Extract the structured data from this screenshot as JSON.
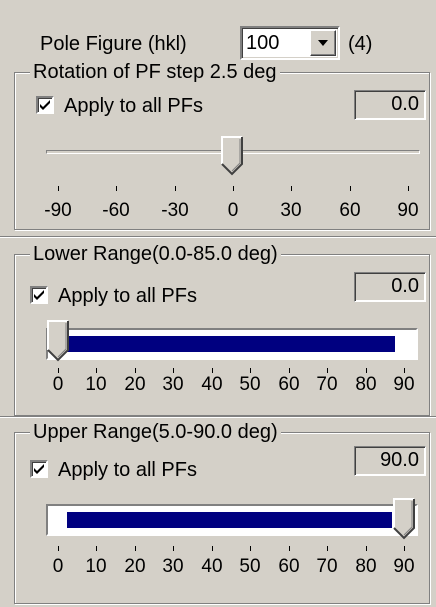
{
  "pole_figure": {
    "label": "Pole Figure (hkl)",
    "selected": "100",
    "count": "(4)",
    "dropdown_icon": "chevron-down-icon"
  },
  "rotation": {
    "title": "Rotation of PF step  2.5 deg",
    "apply_label": "Apply to all PFs",
    "apply_checked": true,
    "value": "0.0",
    "slider_value": 0,
    "min": -90,
    "max": 90,
    "tick_labels": [
      "-90",
      "-60",
      "-30",
      "0",
      "30",
      "60",
      "90"
    ]
  },
  "lower_range": {
    "title": "Lower Range(0.0-85.0 deg)",
    "apply_label": "Apply to all PFs",
    "apply_checked": true,
    "value": "0.0",
    "slider_value": 0,
    "selection": [
      0,
      85
    ],
    "min": 0,
    "max": 90,
    "tick_labels": [
      "0",
      "10",
      "20",
      "30",
      "40",
      "50",
      "60",
      "70",
      "80",
      "90"
    ]
  },
  "upper_range": {
    "title": "Upper Range(5.0-90.0 deg)",
    "apply_label": "Apply to all PFs",
    "apply_checked": true,
    "value": "90.0",
    "slider_value": 90,
    "selection": [
      5,
      90
    ],
    "min": 0,
    "max": 90,
    "tick_labels": [
      "0",
      "10",
      "20",
      "30",
      "40",
      "50",
      "60",
      "70",
      "80",
      "90"
    ]
  },
  "colors": {
    "face": "#d4d0c8",
    "selection": "#000080"
  }
}
